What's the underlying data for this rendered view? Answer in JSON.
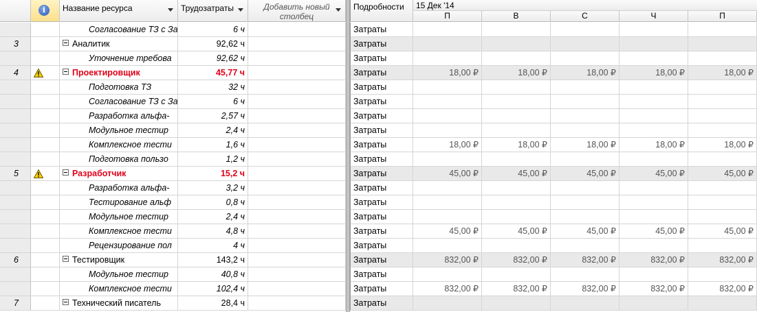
{
  "header": {
    "name_col": "Название ресурса",
    "work_col": "Трудозатраты",
    "add_col": "Добавить новый столбец",
    "details_col": "Подробности",
    "week": "15 Дек '14",
    "days": [
      "П",
      "В",
      "С",
      "Ч",
      "П"
    ]
  },
  "rows": [
    {
      "id": "",
      "name": "Согласование ТЗ с За",
      "work": "6 ч",
      "detail": "Затраты",
      "kind": "sub",
      "costs": [
        "",
        "",
        "",
        "",
        ""
      ]
    },
    {
      "id": "3",
      "name": "Аналитик",
      "work": "92,62 ч",
      "detail": "Затраты",
      "kind": "grp",
      "costs": [
        "",
        "",
        "",
        "",
        ""
      ]
    },
    {
      "id": "",
      "name": "Уточнение требова",
      "work": "92,62 ч",
      "detail": "Затраты",
      "kind": "sub",
      "costs": [
        "",
        "",
        "",
        "",
        ""
      ]
    },
    {
      "id": "4",
      "name": "Проектировщик",
      "work": "45,77 ч",
      "detail": "Затраты",
      "kind": "grp red",
      "warn": true,
      "costs": [
        "18,00 ₽",
        "18,00 ₽",
        "18,00 ₽",
        "18,00 ₽",
        "18,00 ₽"
      ]
    },
    {
      "id": "",
      "name": "Подготовка ТЗ",
      "work": "32 ч",
      "detail": "Затраты",
      "kind": "sub",
      "costs": [
        "",
        "",
        "",
        "",
        ""
      ]
    },
    {
      "id": "",
      "name": "Согласование ТЗ с За",
      "work": "6 ч",
      "detail": "Затраты",
      "kind": "sub",
      "costs": [
        "",
        "",
        "",
        "",
        ""
      ]
    },
    {
      "id": "",
      "name": "Разработка альфа-",
      "work": "2,57 ч",
      "detail": "Затраты",
      "kind": "sub",
      "costs": [
        "",
        "",
        "",
        "",
        ""
      ]
    },
    {
      "id": "",
      "name": "Модульное тестир",
      "work": "2,4 ч",
      "detail": "Затраты",
      "kind": "sub",
      "costs": [
        "",
        "",
        "",
        "",
        ""
      ]
    },
    {
      "id": "",
      "name": "Комплексное тести",
      "work": "1,6 ч",
      "detail": "Затраты",
      "kind": "sub",
      "costs": [
        "18,00 ₽",
        "18,00 ₽",
        "18,00 ₽",
        "18,00 ₽",
        "18,00 ₽"
      ]
    },
    {
      "id": "",
      "name": "Подготовка пользо",
      "work": "1,2 ч",
      "detail": "Затраты",
      "kind": "sub",
      "costs": [
        "",
        "",
        "",
        "",
        ""
      ]
    },
    {
      "id": "5",
      "name": "Разработчик",
      "work": "15,2 ч",
      "detail": "Затраты",
      "kind": "grp red",
      "warn": true,
      "costs": [
        "45,00 ₽",
        "45,00 ₽",
        "45,00 ₽",
        "45,00 ₽",
        "45,00 ₽"
      ]
    },
    {
      "id": "",
      "name": "Разработка альфа-",
      "work": "3,2 ч",
      "detail": "Затраты",
      "kind": "sub",
      "costs": [
        "",
        "",
        "",
        "",
        ""
      ]
    },
    {
      "id": "",
      "name": "Тестирование альф",
      "work": "0,8 ч",
      "detail": "Затраты",
      "kind": "sub",
      "costs": [
        "",
        "",
        "",
        "",
        ""
      ]
    },
    {
      "id": "",
      "name": "Модульное тестир",
      "work": "2,4 ч",
      "detail": "Затраты",
      "kind": "sub",
      "costs": [
        "",
        "",
        "",
        "",
        ""
      ]
    },
    {
      "id": "",
      "name": "Комплексное тести",
      "work": "4,8 ч",
      "detail": "Затраты",
      "kind": "sub",
      "costs": [
        "45,00 ₽",
        "45,00 ₽",
        "45,00 ₽",
        "45,00 ₽",
        "45,00 ₽"
      ]
    },
    {
      "id": "",
      "name": "Рецензирование пол",
      "work": "4 ч",
      "detail": "Затраты",
      "kind": "sub",
      "costs": [
        "",
        "",
        "",
        "",
        ""
      ]
    },
    {
      "id": "6",
      "name": "Тестировщик",
      "work": "143,2 ч",
      "detail": "Затраты",
      "kind": "grp",
      "costs": [
        "832,00 ₽",
        "832,00 ₽",
        "832,00 ₽",
        "832,00 ₽",
        "832,00 ₽"
      ]
    },
    {
      "id": "",
      "name": "Модульное тестир",
      "work": "40,8 ч",
      "detail": "Затраты",
      "kind": "sub",
      "costs": [
        "",
        "",
        "",
        "",
        ""
      ]
    },
    {
      "id": "",
      "name": "Комплексное тести",
      "work": "102,4 ч",
      "detail": "Затраты",
      "kind": "sub",
      "costs": [
        "832,00 ₽",
        "832,00 ₽",
        "832,00 ₽",
        "832,00 ₽",
        "832,00 ₽"
      ]
    },
    {
      "id": "7",
      "name": "Технический писатель",
      "work": "28,4 ч",
      "detail": "Затраты",
      "kind": "grp",
      "costs": [
        "",
        "",
        "",
        "",
        ""
      ]
    }
  ]
}
